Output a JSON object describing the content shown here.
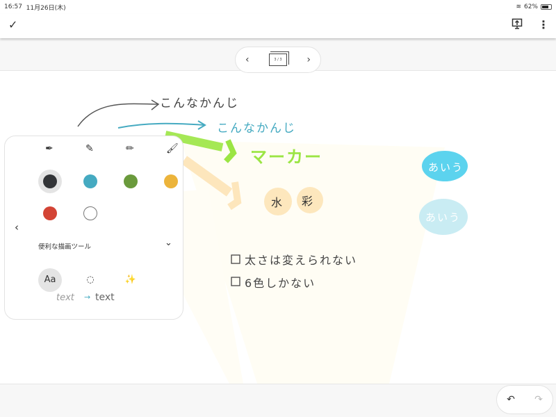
{
  "status": {
    "time": "16:57",
    "date": "11月26日(木)",
    "battery": "62%",
    "battery_level": 0.62
  },
  "toolbar": {
    "done_icon": "checkmark-icon",
    "cast_icon": "present-icon",
    "more_icon": "more-vert-icon"
  },
  "pager": {
    "page": "3 / 3",
    "prev": "‹",
    "next": "›"
  },
  "canvas": {
    "ink_gray": "こんなかんじ",
    "ink_blue": "こんなかんじ",
    "marker": "マーカー",
    "water1": "水",
    "water2": "彩",
    "bubble1": "あいう",
    "bubble2": "あいう",
    "check1": "太さは変えられない",
    "check2": "6色しかない"
  },
  "panel": {
    "pens": [
      "pen",
      "pencil",
      "marker",
      "brush"
    ],
    "colors": [
      "#333538",
      "#45aac1",
      "#6a9a3c",
      "#ecb43b",
      "#d34435",
      "#ffffff"
    ],
    "selected_color": "#333538",
    "section_label": "便利な描画ツール",
    "tools": [
      "text-tool",
      "shape-tool",
      "magic-tool"
    ],
    "text_tool_label": "Aa",
    "hint_hand": "text",
    "hint_arrow": "→",
    "hint_text": "text"
  },
  "undo": {
    "undo": "undo-icon",
    "redo": "redo-icon"
  }
}
